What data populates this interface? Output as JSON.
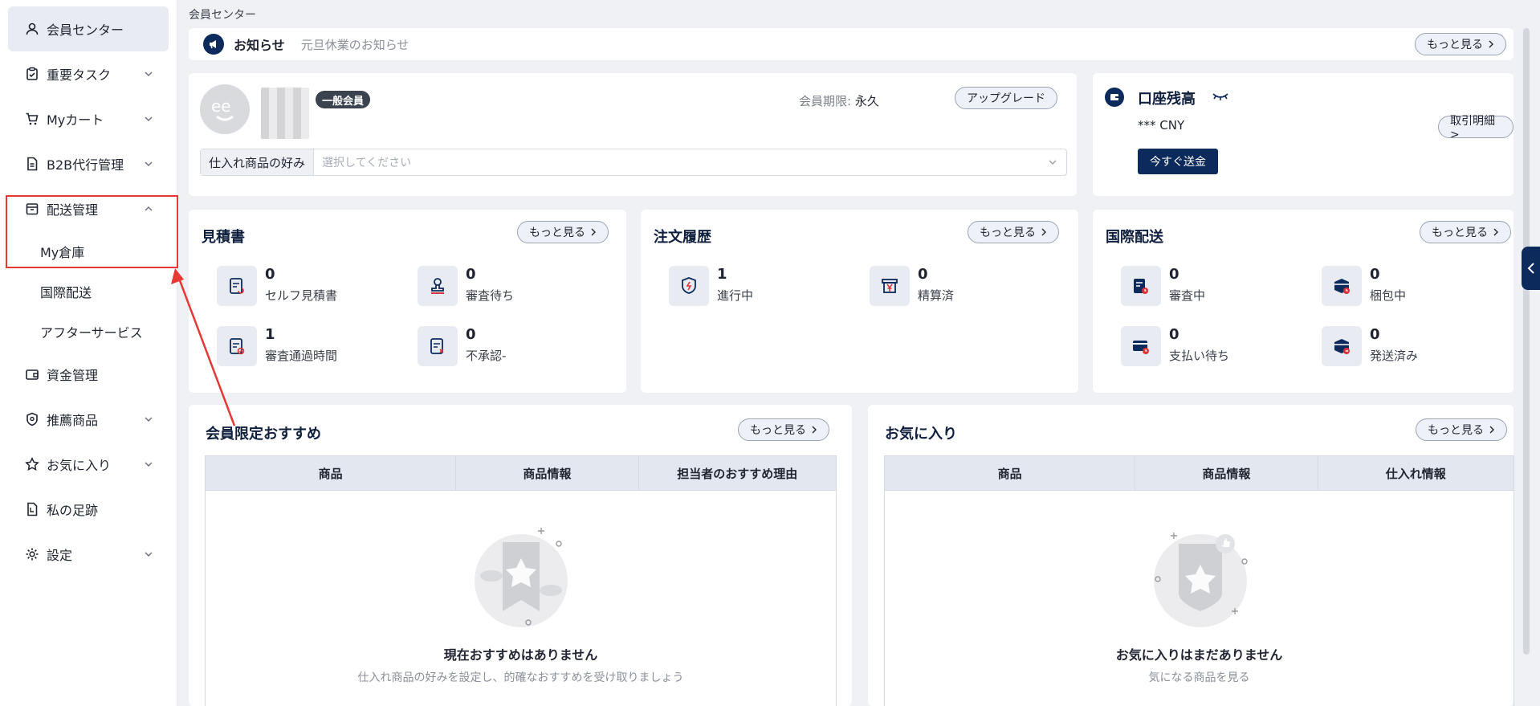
{
  "sidebar": {
    "items": [
      {
        "label": "会員センター",
        "icon": "user-icon"
      },
      {
        "label": "重要タスク",
        "icon": "clipboard-check-icon"
      },
      {
        "label": "Myカート",
        "icon": "cart-icon"
      },
      {
        "label": "B2B代行管理",
        "icon": "document-icon"
      },
      {
        "label": "配送管理",
        "icon": "box-icon"
      },
      {
        "label": "資金管理",
        "icon": "wallet-icon"
      },
      {
        "label": "推薦商品",
        "icon": "badge-icon"
      },
      {
        "label": "お気に入り",
        "icon": "star-icon"
      },
      {
        "label": "私の足跡",
        "icon": "footprint-icon"
      },
      {
        "label": "設定",
        "icon": "gear-icon"
      }
    ],
    "sub_items": [
      "My倉庫",
      "国際配送",
      "アフターサービス"
    ]
  },
  "breadcrumb": "会員センター",
  "notice": {
    "title": "お知らせ",
    "text": "元旦休業のお知らせ",
    "more": "もっと見る"
  },
  "member": {
    "badge": "一般会員",
    "expiry_label": "会員期限:",
    "expiry_value": "永久",
    "upgrade": "アップグレード",
    "pref_label": "仕入れ商品の好み",
    "pref_placeholder": "選択してください"
  },
  "balance": {
    "title": "口座残高",
    "value": "*** CNY",
    "details": "取引明細 >",
    "send": "今すぐ送金"
  },
  "quotes": {
    "title": "見積書",
    "more": "もっと見る",
    "stats": [
      {
        "num": "0",
        "label": "セルフ見積書"
      },
      {
        "num": "0",
        "label": "審査待ち"
      },
      {
        "num": "1",
        "label": "審査通過時間"
      },
      {
        "num": "0",
        "label": "不承認-"
      }
    ]
  },
  "orders": {
    "title": "注文履歴",
    "more": "もっと見る",
    "stats": [
      {
        "num": "1",
        "label": "進行中"
      },
      {
        "num": "0",
        "label": "精算済"
      }
    ]
  },
  "intl": {
    "title": "国際配送",
    "more": "もっと見る",
    "stats": [
      {
        "num": "0",
        "label": "審査中"
      },
      {
        "num": "0",
        "label": "梱包中"
      },
      {
        "num": "0",
        "label": "支払い待ち"
      },
      {
        "num": "0",
        "label": "発送済み"
      }
    ]
  },
  "recommend": {
    "title": "会員限定おすすめ",
    "more": "もっと見る",
    "cols": [
      "商品",
      "商品情報",
      "担当者のおすすめ理由"
    ],
    "empty_title": "現在おすすめはありません",
    "empty_sub": "仕入れ商品の好みを設定し、的確なおすすめを受け取りましょう"
  },
  "favorites": {
    "title": "お気に入り",
    "more": "もっと見る",
    "cols": [
      "商品",
      "商品情報",
      "仕入れ情報"
    ],
    "empty_title": "お気に入りはまだありません",
    "empty_sub": "気になる商品を見る"
  },
  "colors": {
    "accent": "#0d2a5c",
    "highlight": "#e53935",
    "bg": "#f0f1f4"
  }
}
